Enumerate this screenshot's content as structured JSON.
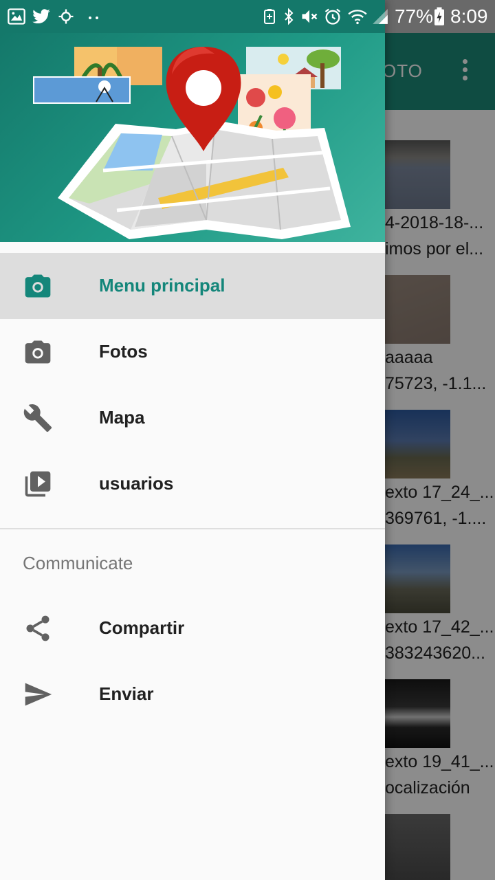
{
  "status_bar": {
    "battery_text": "77%",
    "time": "8:09"
  },
  "background_app": {
    "toolbar_title_partial": "OTO",
    "items": [
      {
        "line1": "4-2018-18-...",
        "line2": "imos por el..."
      },
      {
        "line1": "aaaaa",
        "line2": "75723, -1.1..."
      },
      {
        "line1": "exto 17_24_...",
        "line2": "369761, -1...."
      },
      {
        "line1": "exto 17_42_...",
        "line2": "383243620..."
      },
      {
        "line1": "exto 19_41_...",
        "line2": "ocalización"
      }
    ]
  },
  "drawer": {
    "header_image": "map-pin-photos-illustration",
    "menu": [
      {
        "label": "Menu principal",
        "icon": "camera-icon",
        "active": true
      },
      {
        "label": "Fotos",
        "icon": "camera-icon",
        "active": false
      },
      {
        "label": "Mapa",
        "icon": "wrench-icon",
        "active": false
      },
      {
        "label": "usuarios",
        "icon": "video-library-icon",
        "active": false
      }
    ],
    "section_title": "Communicate",
    "communicate": [
      {
        "label": "Compartir",
        "icon": "share-icon"
      },
      {
        "label": "Enviar",
        "icon": "send-icon"
      }
    ]
  },
  "colors": {
    "primary": "#1c8a78",
    "primary_dark": "#14786a",
    "accent_text": "#14867a",
    "icon_gray": "#616161",
    "active_bg": "#dddddd"
  }
}
